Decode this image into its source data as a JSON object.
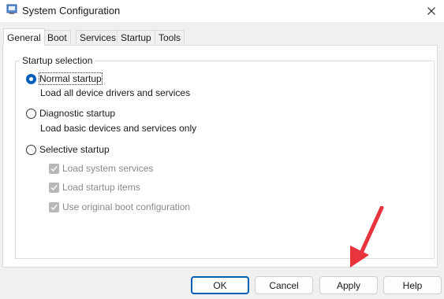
{
  "window": {
    "title": "System Configuration",
    "app_icon": "msconfig-icon",
    "close_icon": "close-icon"
  },
  "tabs": [
    {
      "label": "General",
      "active": true
    },
    {
      "label": "Boot",
      "active": false
    },
    {
      "label": "Services",
      "active": false
    },
    {
      "label": "Startup",
      "active": false
    },
    {
      "label": "Tools",
      "active": false
    }
  ],
  "startup_selection": {
    "legend": "Startup selection",
    "normal": {
      "label": "Normal startup",
      "description": "Load all device drivers and services",
      "checked": true
    },
    "diagnostic": {
      "label": "Diagnostic startup",
      "description": "Load basic devices and services only",
      "checked": false
    },
    "selective": {
      "label": "Selective startup",
      "checked": false
    },
    "options": [
      {
        "label": "Load system services",
        "checked": true,
        "enabled": false
      },
      {
        "label": "Load startup items",
        "checked": true,
        "enabled": false
      },
      {
        "label": "Use original boot configuration",
        "checked": true,
        "enabled": false
      }
    ]
  },
  "buttons": {
    "ok": "OK",
    "cancel": "Cancel",
    "apply": "Apply",
    "help": "Help"
  },
  "colors": {
    "accent": "#005fb8",
    "annotation_arrow": "#e8343c"
  }
}
